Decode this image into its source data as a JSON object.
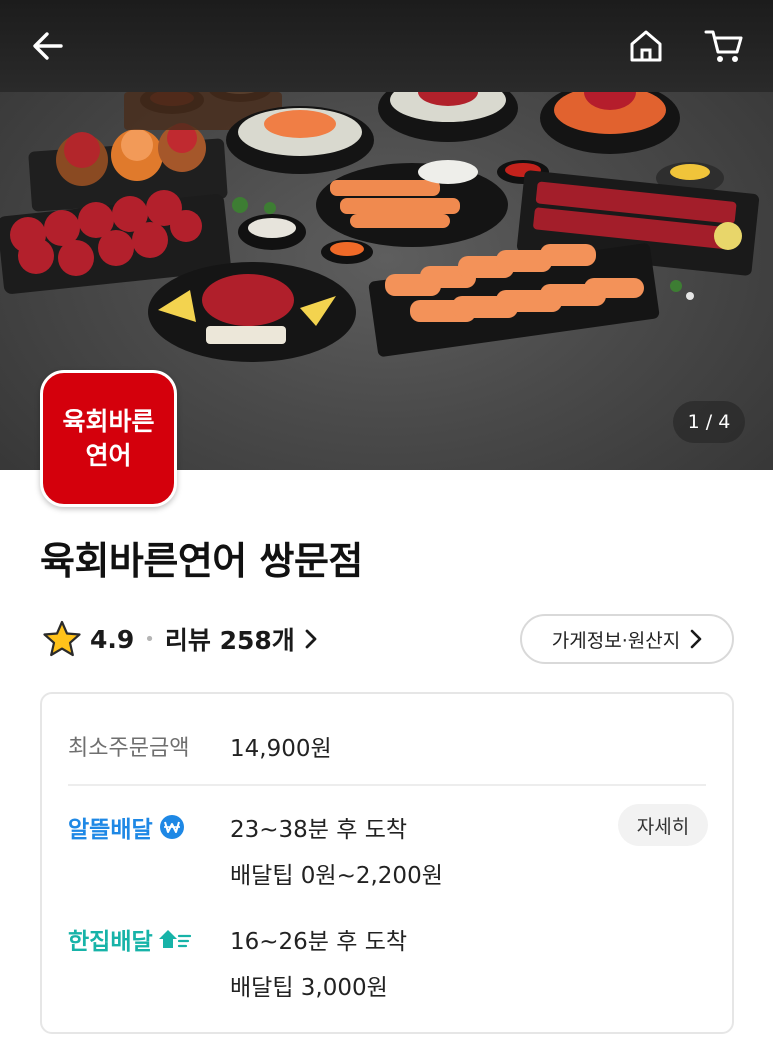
{
  "hero": {
    "image_counter": "1 / 4",
    "icons": {
      "back": "arrow-left-icon",
      "home": "home-icon",
      "cart": "cart-icon"
    }
  },
  "logo": {
    "line1": "육회바른",
    "line2": "연어",
    "color": "#d4000c"
  },
  "store": {
    "name": "육회바른연어 쌍문점",
    "rating": "4.9",
    "review_label": "리뷰 258개",
    "info_button": "가게정보·원산지"
  },
  "order": {
    "min_order_label": "최소주문금액",
    "min_order_value": "14,900원"
  },
  "delivery": [
    {
      "name": "알뜰배달",
      "eta": "23~38분 후 도착",
      "tip": "배달팁 0원~2,200원",
      "detail_button": "자세히",
      "color": "#1e88e5"
    },
    {
      "name": "한집배달",
      "eta": "16~26분 후 도착",
      "tip": "배달팁 3,000원",
      "color": "#17b3a8"
    }
  ]
}
